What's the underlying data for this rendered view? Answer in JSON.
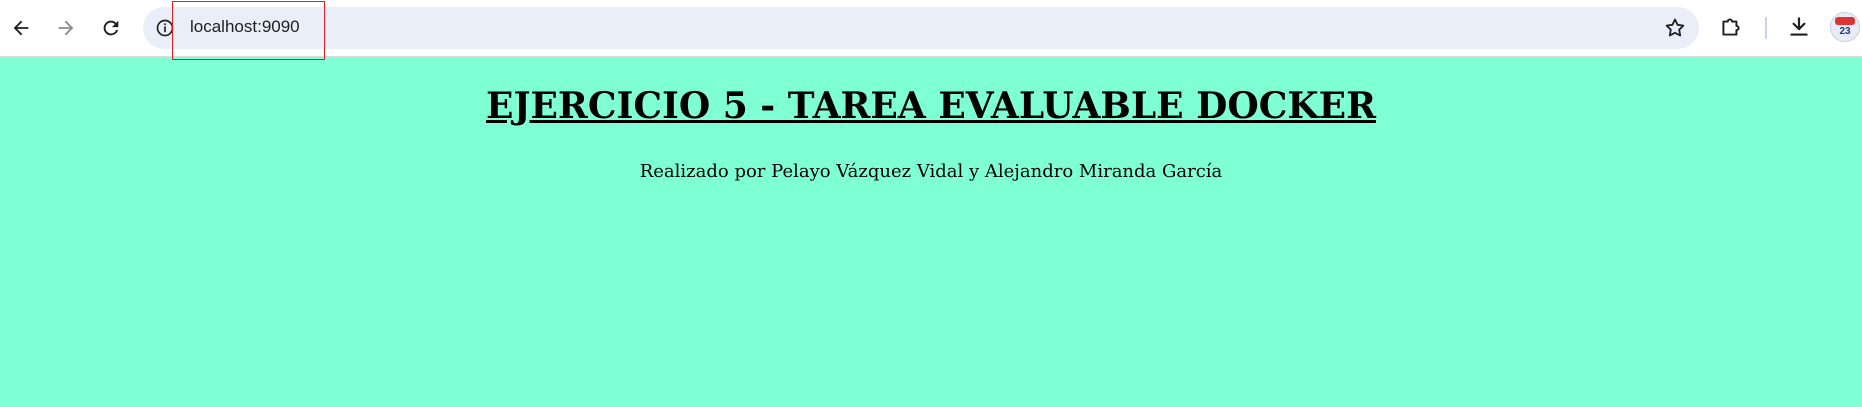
{
  "browser": {
    "url": "localhost:9090",
    "icons": [
      "back-arrow-icon",
      "forward-arrow-icon",
      "reload-icon",
      "site-info-icon",
      "bookmark-star-icon",
      "extensions-icon",
      "download-icon",
      "profile-avatar"
    ],
    "avatar_badge": "23"
  },
  "page": {
    "title": "EJERCICIO 5 - TAREA EVALUABLE DOCKER",
    "subtitle": "Realizado por Pelayo Vázquez Vidal y Alejandro Miranda García",
    "background_color": "#7fffd4"
  }
}
